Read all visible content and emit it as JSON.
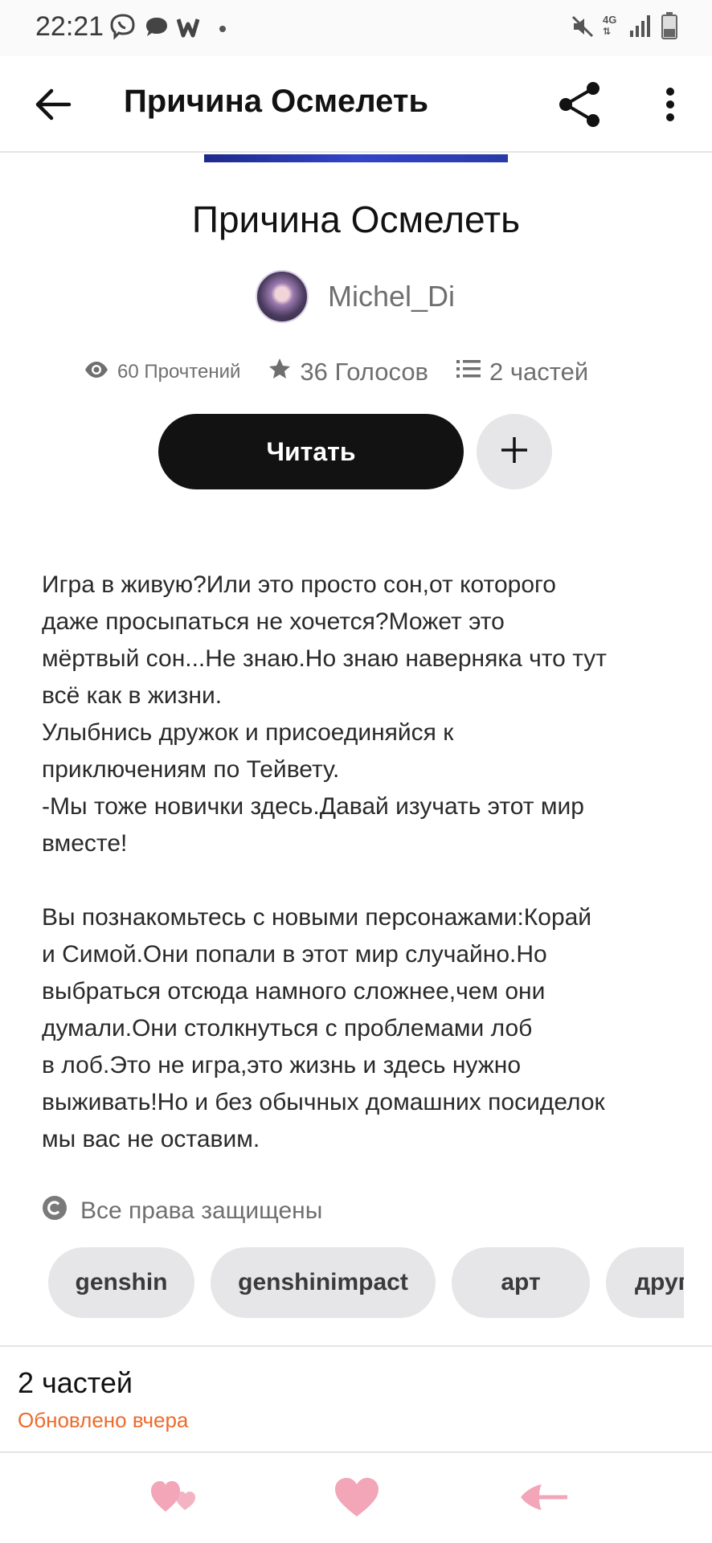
{
  "status_bar": {
    "time": "22:21",
    "network_label": "4G",
    "icons": [
      "viber-icon",
      "message-icon",
      "w-app-icon",
      "dot-icon",
      "mute-icon",
      "network-4g-icon",
      "signal-icon",
      "battery-icon"
    ]
  },
  "app_bar": {
    "title": "Причина Осмелеть",
    "icons": [
      "back-arrow-icon",
      "share-icon",
      "more-vert-icon"
    ]
  },
  "story": {
    "title": "Причина Осмелеть",
    "author": "Michel_Di",
    "stats": {
      "reads": "60 Прочтений",
      "votes": "36 Голосов",
      "parts": "2 частей"
    },
    "read_button": "Читать",
    "add_button_icon": "plus-icon",
    "description": [
      "Игра в живую?Или это просто сон,от которого\nдаже просыпаться не хочется?Может это\nмёртвый сон...Не знаю.Но знаю наверняка что тут\nвсё как в жизни.\nУлыбнись дружок и присоединяйся к\nприключениям по Тейвету.\n-Мы тоже новички здесь.Давай изучать этот мир\nвместе!",
      "Вы познакомьтесь с новыми персонажами:Корай\nи Симой.Они попали в этот мир случайно.Но\nвыбраться отсюда намного сложнее,чем они\nдумали.Они столкнуться с проблемами лоб\nв лоб.Это не игра,это жизнь и здесь нужно\nвыживать!Но и без обычных домашних посиделок\nмы вас не оставим."
    ],
    "rights": "Все права защищены",
    "tags": [
      "genshin",
      "genshinimpact",
      "арт",
      "друг"
    ]
  },
  "parts_section": {
    "title": "2 частей",
    "updated": "Обновлено вчера"
  },
  "bottom_nav": {
    "icons": [
      "hearts-icon",
      "heart-icon",
      "arrow-back-icon"
    ]
  },
  "colors": {
    "accent_orange": "#ec6b2d",
    "button_dark": "#121212",
    "chip_bg": "#e6e6e8",
    "bottom_icons_pink": "#f2a6b8"
  }
}
